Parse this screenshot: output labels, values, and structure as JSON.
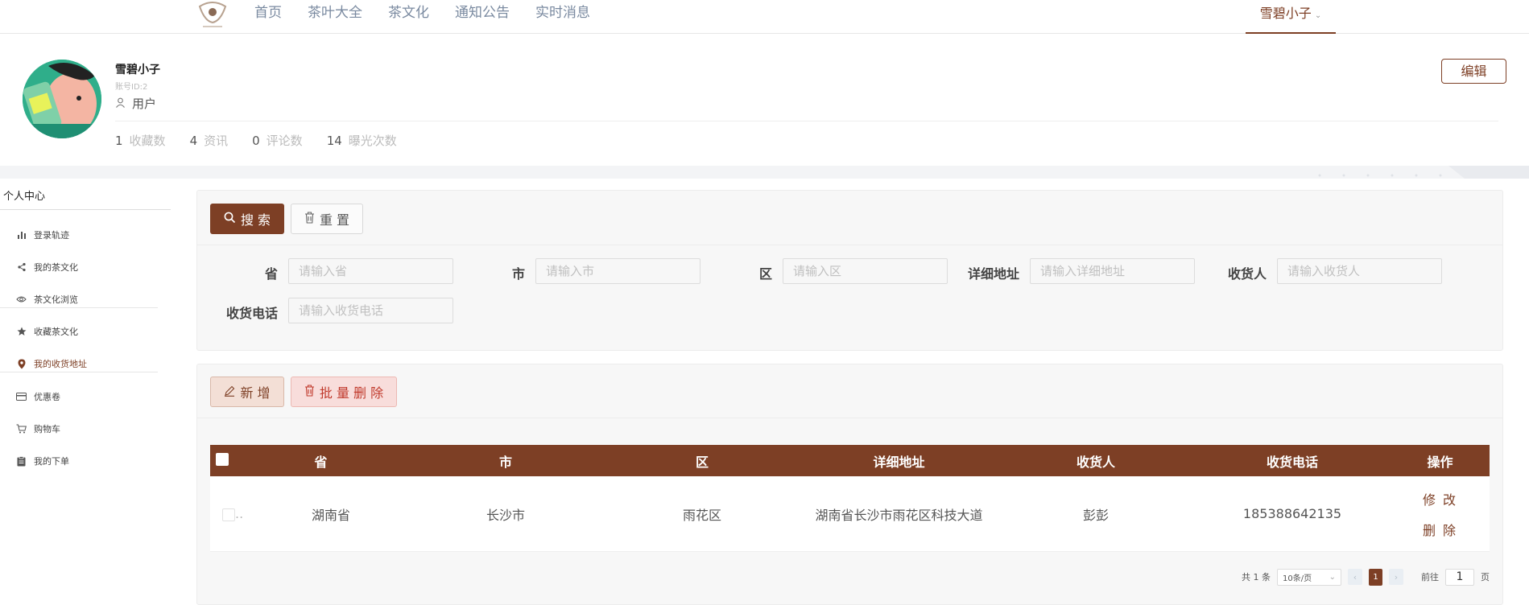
{
  "nav": {
    "items": [
      "首页",
      "茶叶大全",
      "茶文化",
      "通知公告",
      "实时消息"
    ],
    "user": "雪碧小子"
  },
  "profile": {
    "name": "雪碧小子",
    "account_id": "账号ID:2",
    "role": "用户",
    "edit_label": "编辑",
    "stats": [
      {
        "value": "1",
        "label": "收藏数"
      },
      {
        "value": "4",
        "label": "资讯"
      },
      {
        "value": "0",
        "label": "评论数"
      },
      {
        "value": "14",
        "label": "曝光次数"
      }
    ]
  },
  "sidebar": {
    "title": "个人中心",
    "items": [
      {
        "label": "登录轨迹",
        "icon": "bar-chart-icon"
      },
      {
        "label": "我的茶文化",
        "icon": "share-icon"
      },
      {
        "label": "茶文化浏览",
        "icon": "eye-icon"
      },
      {
        "label": "收藏茶文化",
        "icon": "star-icon"
      },
      {
        "label": "我的收货地址",
        "icon": "location-pin-icon",
        "active": true
      },
      {
        "label": "优惠卷",
        "icon": "credit-card-icon"
      },
      {
        "label": "购物车",
        "icon": "cart-icon"
      },
      {
        "label": "我的下单",
        "icon": "clipboard-icon"
      }
    ]
  },
  "search": {
    "search_label": "搜 索",
    "reset_label": "重 置",
    "fields": [
      {
        "label": "省",
        "placeholder": "请输入省"
      },
      {
        "label": "市",
        "placeholder": "请输入市"
      },
      {
        "label": "区",
        "placeholder": "请输入区"
      },
      {
        "label": "详细地址",
        "placeholder": "请输入详细地址"
      },
      {
        "label": "收货人",
        "placeholder": "请输入收货人"
      },
      {
        "label": "收货电话",
        "placeholder": "请输入收货电话"
      }
    ]
  },
  "actions": {
    "add_label": "新 增",
    "batch_delete_label": "批 量 删 除"
  },
  "table": {
    "columns": [
      "省",
      "市",
      "区",
      "详细地址",
      "收货人",
      "收货电话",
      "操作"
    ],
    "rows": [
      {
        "province": "湖南省",
        "city": "长沙市",
        "district": "雨花区",
        "address": "湖南省长沙市雨花区科技大道",
        "receiver": "彭彭",
        "phone": "185388642135",
        "edit": "修 改",
        "delete": "删 除"
      }
    ]
  },
  "pagination": {
    "total": "共 1 条",
    "page_size": "10条/页",
    "current_page": "1",
    "goto_prefix": "前往",
    "goto_value": "1",
    "goto_suffix": "页"
  },
  "colors": {
    "brand": "#7d3f25"
  }
}
